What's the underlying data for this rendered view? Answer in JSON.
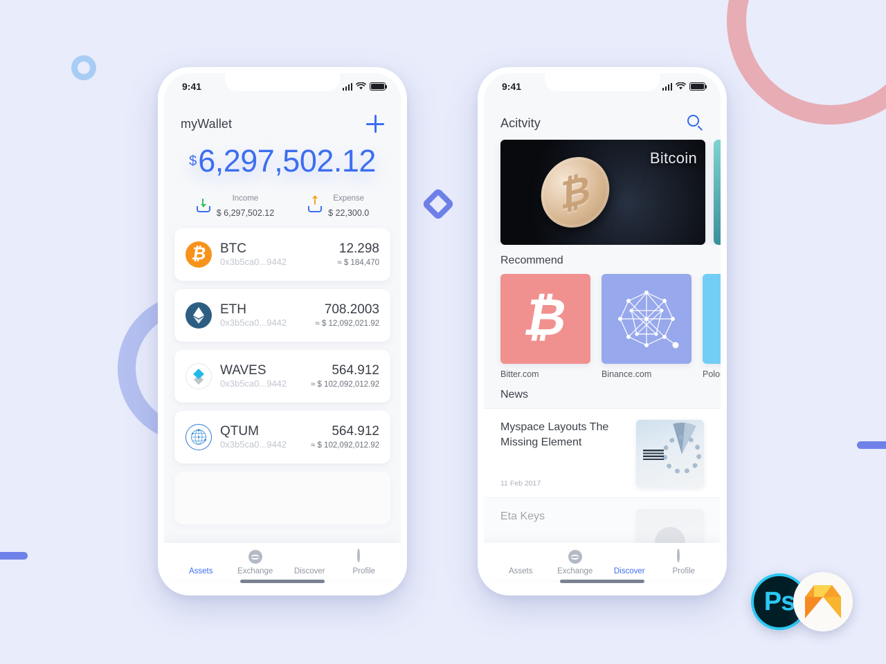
{
  "background": {
    "page_color": "#e8ecfb",
    "shapes": [
      "pink-ring",
      "periwinkle-ring",
      "blue-ring",
      "blue-diamond",
      "blue-bar-left",
      "blue-bar-right"
    ]
  },
  "badges": {
    "photoshop": "Ps",
    "sketch": "sketch-gem"
  },
  "wallet_screen": {
    "status_bar": {
      "time": "9:41"
    },
    "nav": {
      "title": "myWallet",
      "add_label": "+"
    },
    "balance": {
      "currency_symbol": "$",
      "amount": "6,297,502.12",
      "accent_color": "#3d6ef0"
    },
    "summary": [
      {
        "label": "Income",
        "value": "$ 6,297,502.12",
        "icon": "income-icon",
        "arrow_color": "#36c06a"
      },
      {
        "label": "Expense",
        "value": "$ 22,300.0",
        "icon": "expense-icon",
        "arrow_color": "#f5a623"
      }
    ],
    "assets": [
      {
        "symbol": "BTC",
        "address": "0x3b5ca0...9442",
        "amount": "12.298",
        "fiat": "≈ $ 184,470",
        "icon": "btc-coin-icon"
      },
      {
        "symbol": "ETH",
        "address": "0x3b5ca0...9442",
        "amount": "708.2003",
        "fiat": "≈ $ 12,092,021.92",
        "icon": "eth-coin-icon"
      },
      {
        "symbol": "WAVES",
        "address": "0x3b5ca0...9442",
        "amount": "564.912",
        "fiat": "≈ $ 102,092,012.92",
        "icon": "waves-coin-icon"
      },
      {
        "symbol": "QTUM",
        "address": "0x3b5ca0...9442",
        "amount": "564.912",
        "fiat": "≈ $ 102,092,012.92",
        "icon": "qtum-coin-icon"
      }
    ],
    "tabs": [
      {
        "label": "Assets",
        "active": true
      },
      {
        "label": "Exchange",
        "active": false
      },
      {
        "label": "Discover",
        "active": false
      },
      {
        "label": "Profile",
        "active": false
      }
    ]
  },
  "discover_screen": {
    "status_bar": {
      "time": "9:41"
    },
    "nav": {
      "title": "Acitvity",
      "search_icon": "search-icon"
    },
    "banner": {
      "label": "Bitcoin"
    },
    "sections": {
      "recommend": "Recommend",
      "news": "News"
    },
    "recommend": [
      {
        "name": "Bitter.com",
        "color": "#f0918f",
        "icon": "bitcoin-b-icon"
      },
      {
        "name": "Binance.com",
        "color": "#97a8ec",
        "icon": "binance-network-icon"
      },
      {
        "name": "Polone",
        "color": "#73cef5",
        "icon": "poloniex-icon"
      }
    ],
    "news": [
      {
        "title": "Myspace Layouts The Missing Element",
        "date": "11 Feb 2017",
        "thumb": "ibm-servers-thumb"
      },
      {
        "title": "Eta Keys",
        "date": "",
        "thumb": "person-thumb"
      }
    ],
    "tabs": [
      {
        "label": "Assets",
        "active": false
      },
      {
        "label": "Exchange",
        "active": false
      },
      {
        "label": "Discover",
        "active": true
      },
      {
        "label": "Profile",
        "active": false
      }
    ]
  }
}
